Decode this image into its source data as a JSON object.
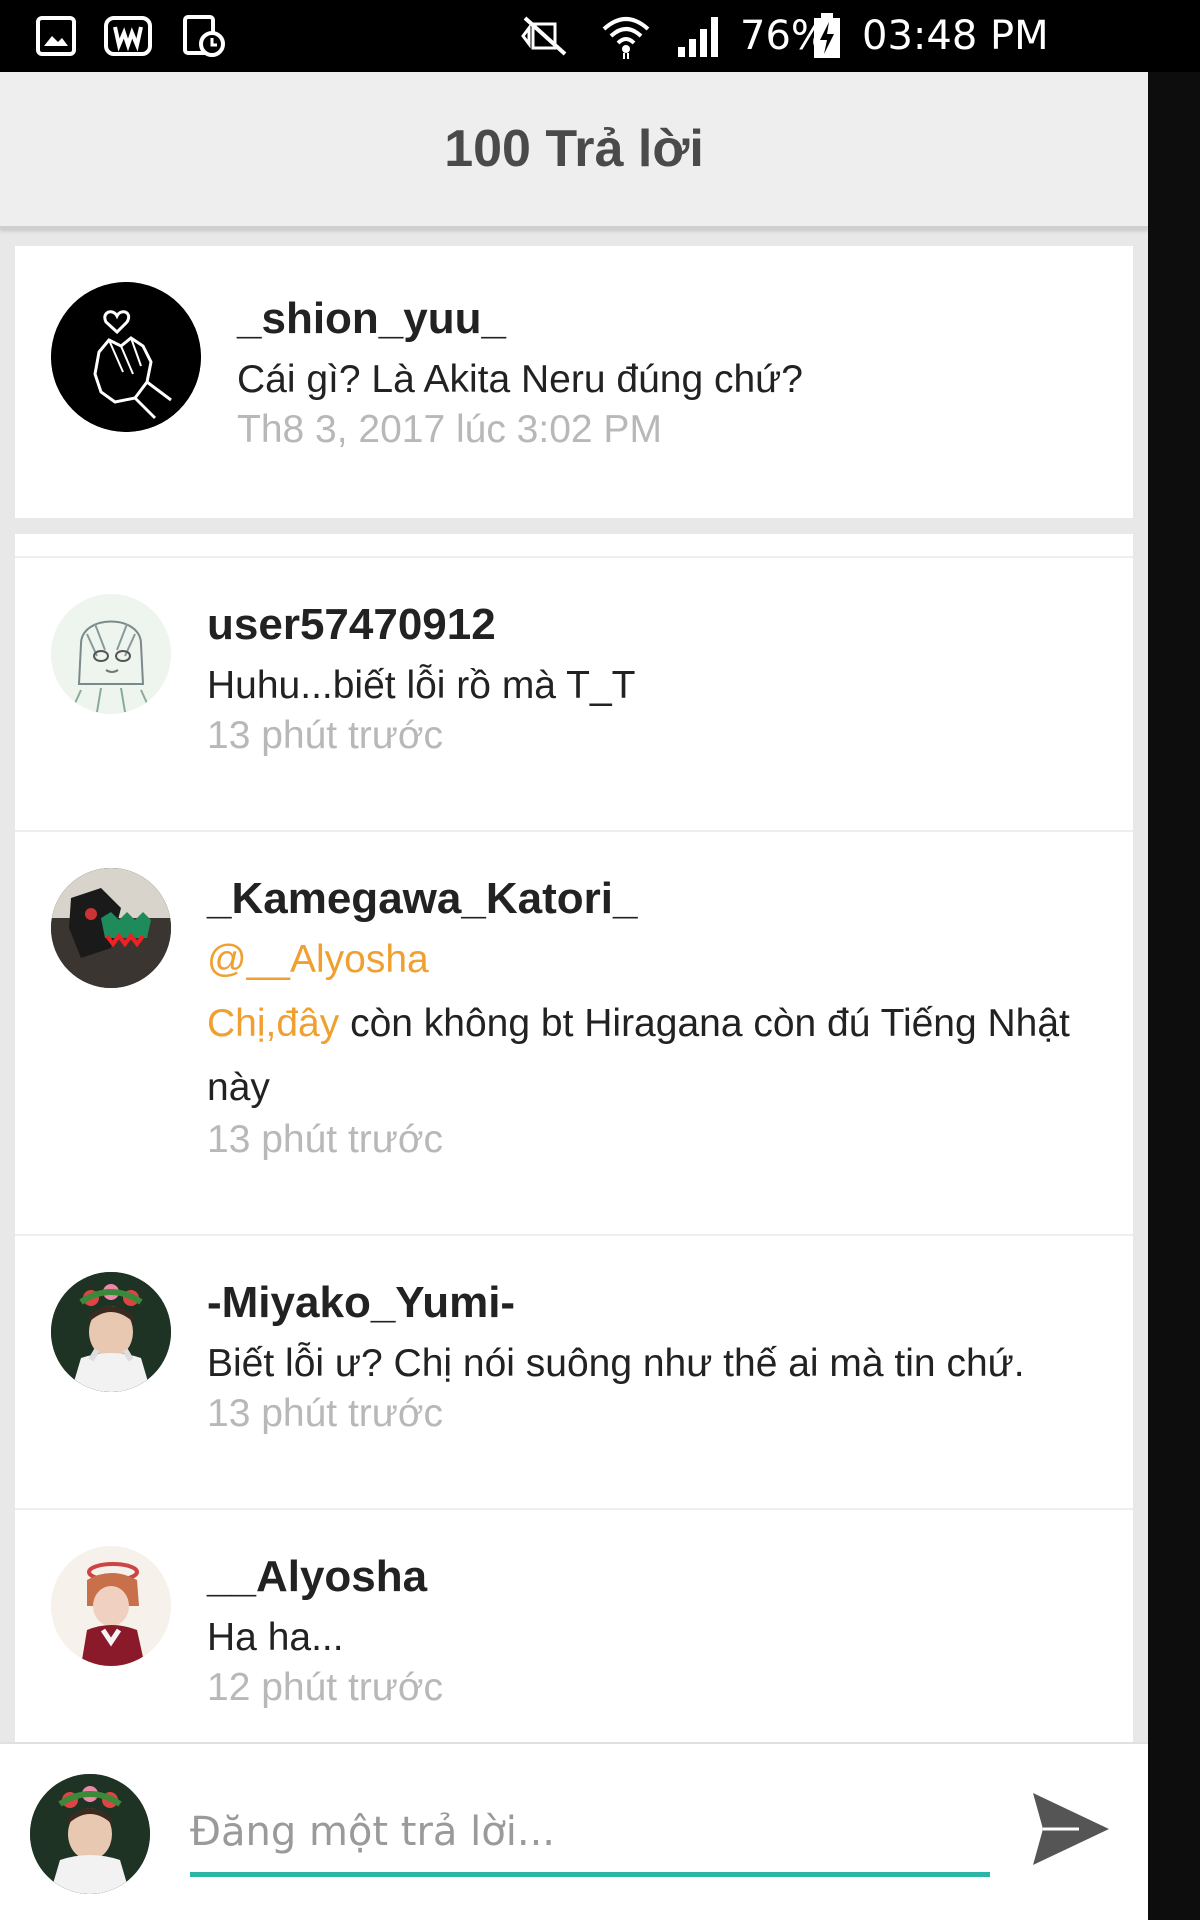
{
  "status_bar": {
    "battery_percent": "76%",
    "time": "03:48 PM",
    "icons": [
      "gallery-icon",
      "w-app-icon",
      "clock-file-icon",
      "mute-icon",
      "wifi-icon",
      "signal-icon",
      "battery-charging-icon"
    ]
  },
  "header": {
    "title": "100 Trả lời"
  },
  "top_comment": {
    "username": "_shion_yuu_",
    "message": "Cái gì? Là Akita Neru đúng chứ?",
    "time": "Th8 3, 2017 lúc 3:02 PM"
  },
  "replies": [
    {
      "username": "user57470912",
      "message": "Huhu...biết lỗi rồ mà T_T",
      "time": "13 phút trước"
    },
    {
      "username": "_Kamegawa_Katori_",
      "mention": "@__Alyosha",
      "message_highlight": "Chị,đây",
      "message": " còn không bt Hiragana còn đú Tiếng Nhật này",
      "time": "13 phút trước"
    },
    {
      "username": "-Miyako_Yumi-",
      "message": "Biết lỗi ư? Chị nói suông như thế ai mà tin chứ.",
      "time": "13 phút trước"
    },
    {
      "username": "__Alyosha",
      "message": "Ha ha...",
      "time": "12 phút trước"
    }
  ],
  "composer": {
    "placeholder": "Đăng một trả lời...",
    "value": ""
  },
  "colors": {
    "mention": "#f0a030",
    "input_underline": "#2bb5a5",
    "send_icon": "#555555"
  }
}
